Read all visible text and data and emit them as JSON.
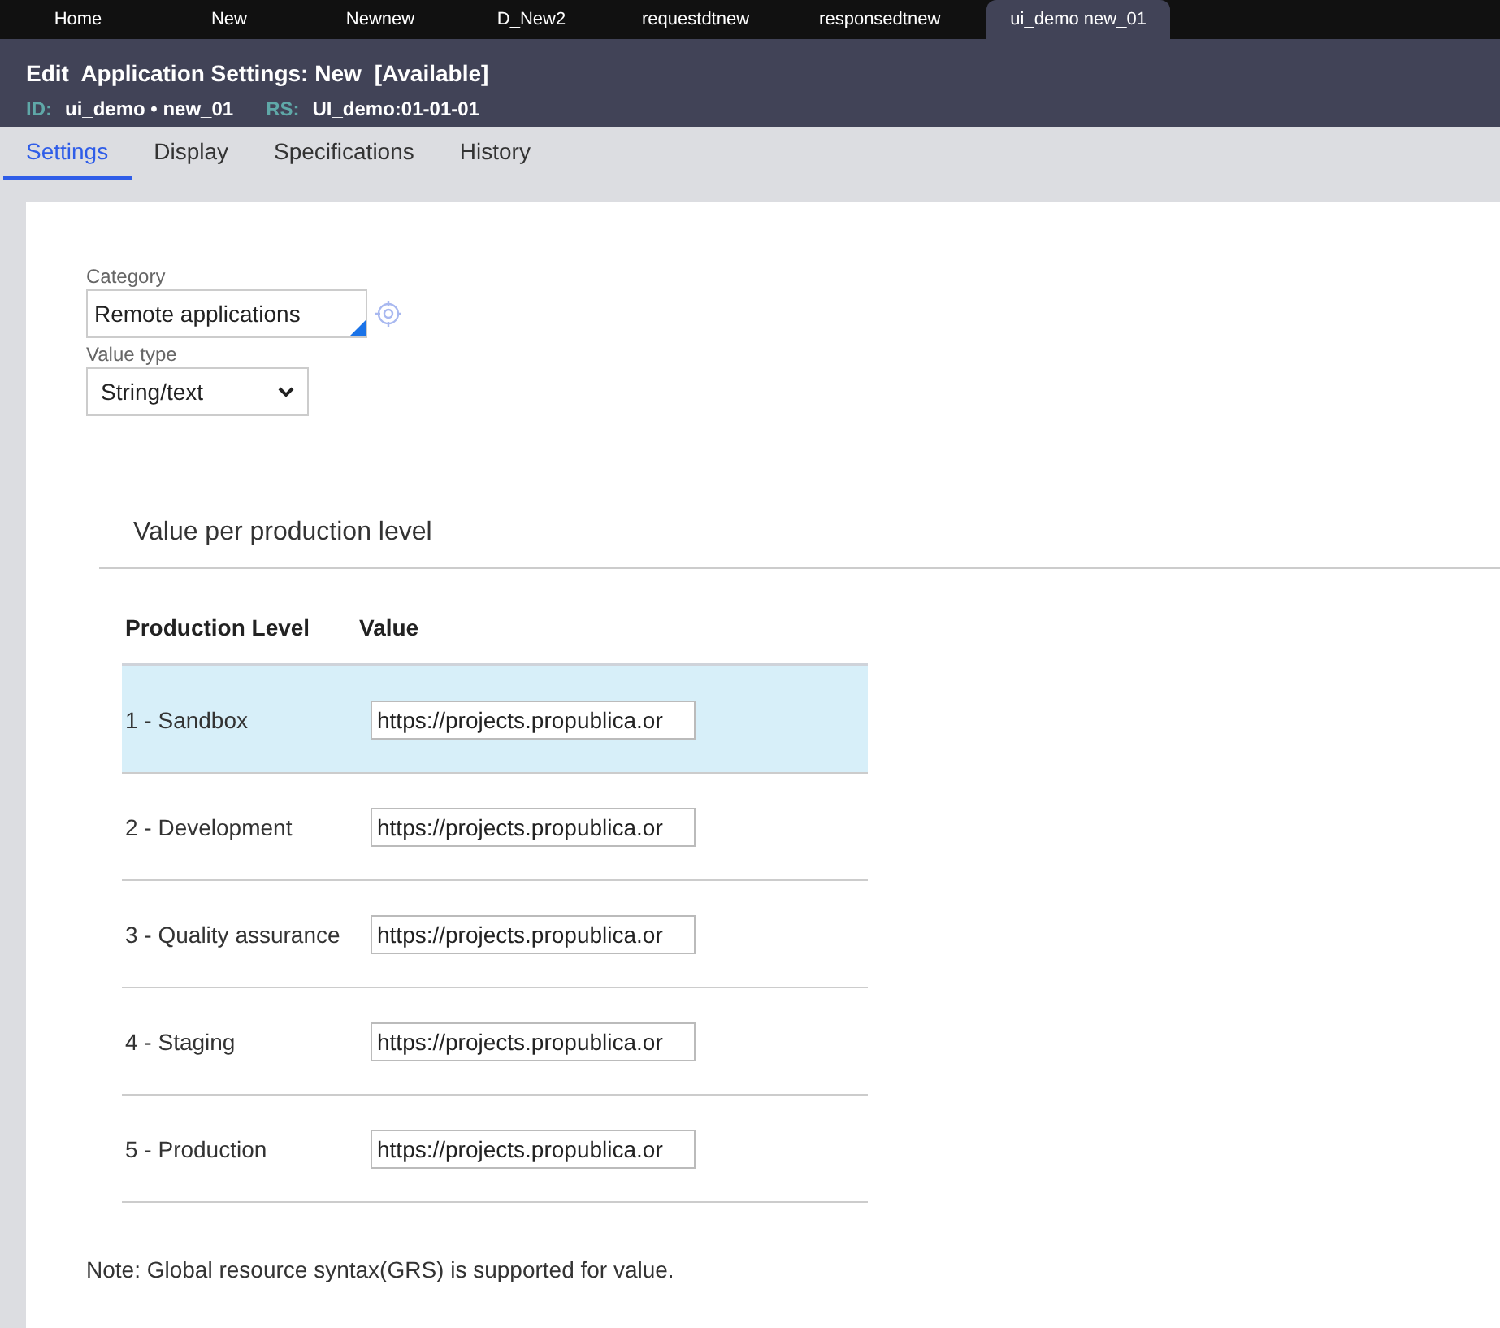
{
  "doc_tabs": [
    {
      "label": "Home",
      "selected": false
    },
    {
      "label": "New",
      "selected": false
    },
    {
      "label": "Newnew",
      "selected": false
    },
    {
      "label": "D_New2",
      "selected": false
    },
    {
      "label": "requestdtnew",
      "selected": false
    },
    {
      "label": "responsedtnew",
      "selected": false
    },
    {
      "label": "ui_demo new_01",
      "selected": true
    }
  ],
  "header": {
    "title": "Edit  Application Settings: New",
    "status": "[Available]",
    "id_label": "ID:",
    "id_value": "ui_demo • new_01",
    "rs_label": "RS:",
    "rs_value": "UI_demo:01-01-01"
  },
  "tabs": [
    {
      "label": "Settings",
      "selected": true
    },
    {
      "label": "Display",
      "selected": false
    },
    {
      "label": "Specifications",
      "selected": false
    },
    {
      "label": "History",
      "selected": false
    }
  ],
  "category": {
    "label": "Category",
    "value": "Remote applications"
  },
  "value_type": {
    "label": "Value type",
    "value": "String/text"
  },
  "section_title": "Value per production level",
  "table": {
    "columns": [
      "Production Level",
      "Value"
    ],
    "rows": [
      {
        "level": "1 - Sandbox",
        "value": "https://projects.propublica.or",
        "selected": true
      },
      {
        "level": "2 - Development",
        "value": "https://projects.propublica.or",
        "selected": false
      },
      {
        "level": "3 - Quality assurance",
        "value": "https://projects.propublica.or",
        "selected": false
      },
      {
        "level": "4 - Staging",
        "value": "https://projects.propublica.or",
        "selected": false
      },
      {
        "level": "5 - Production",
        "value": "https://projects.propublica.or",
        "selected": false
      }
    ]
  },
  "note": "Note: Global resource syntax(GRS) is supported for value."
}
